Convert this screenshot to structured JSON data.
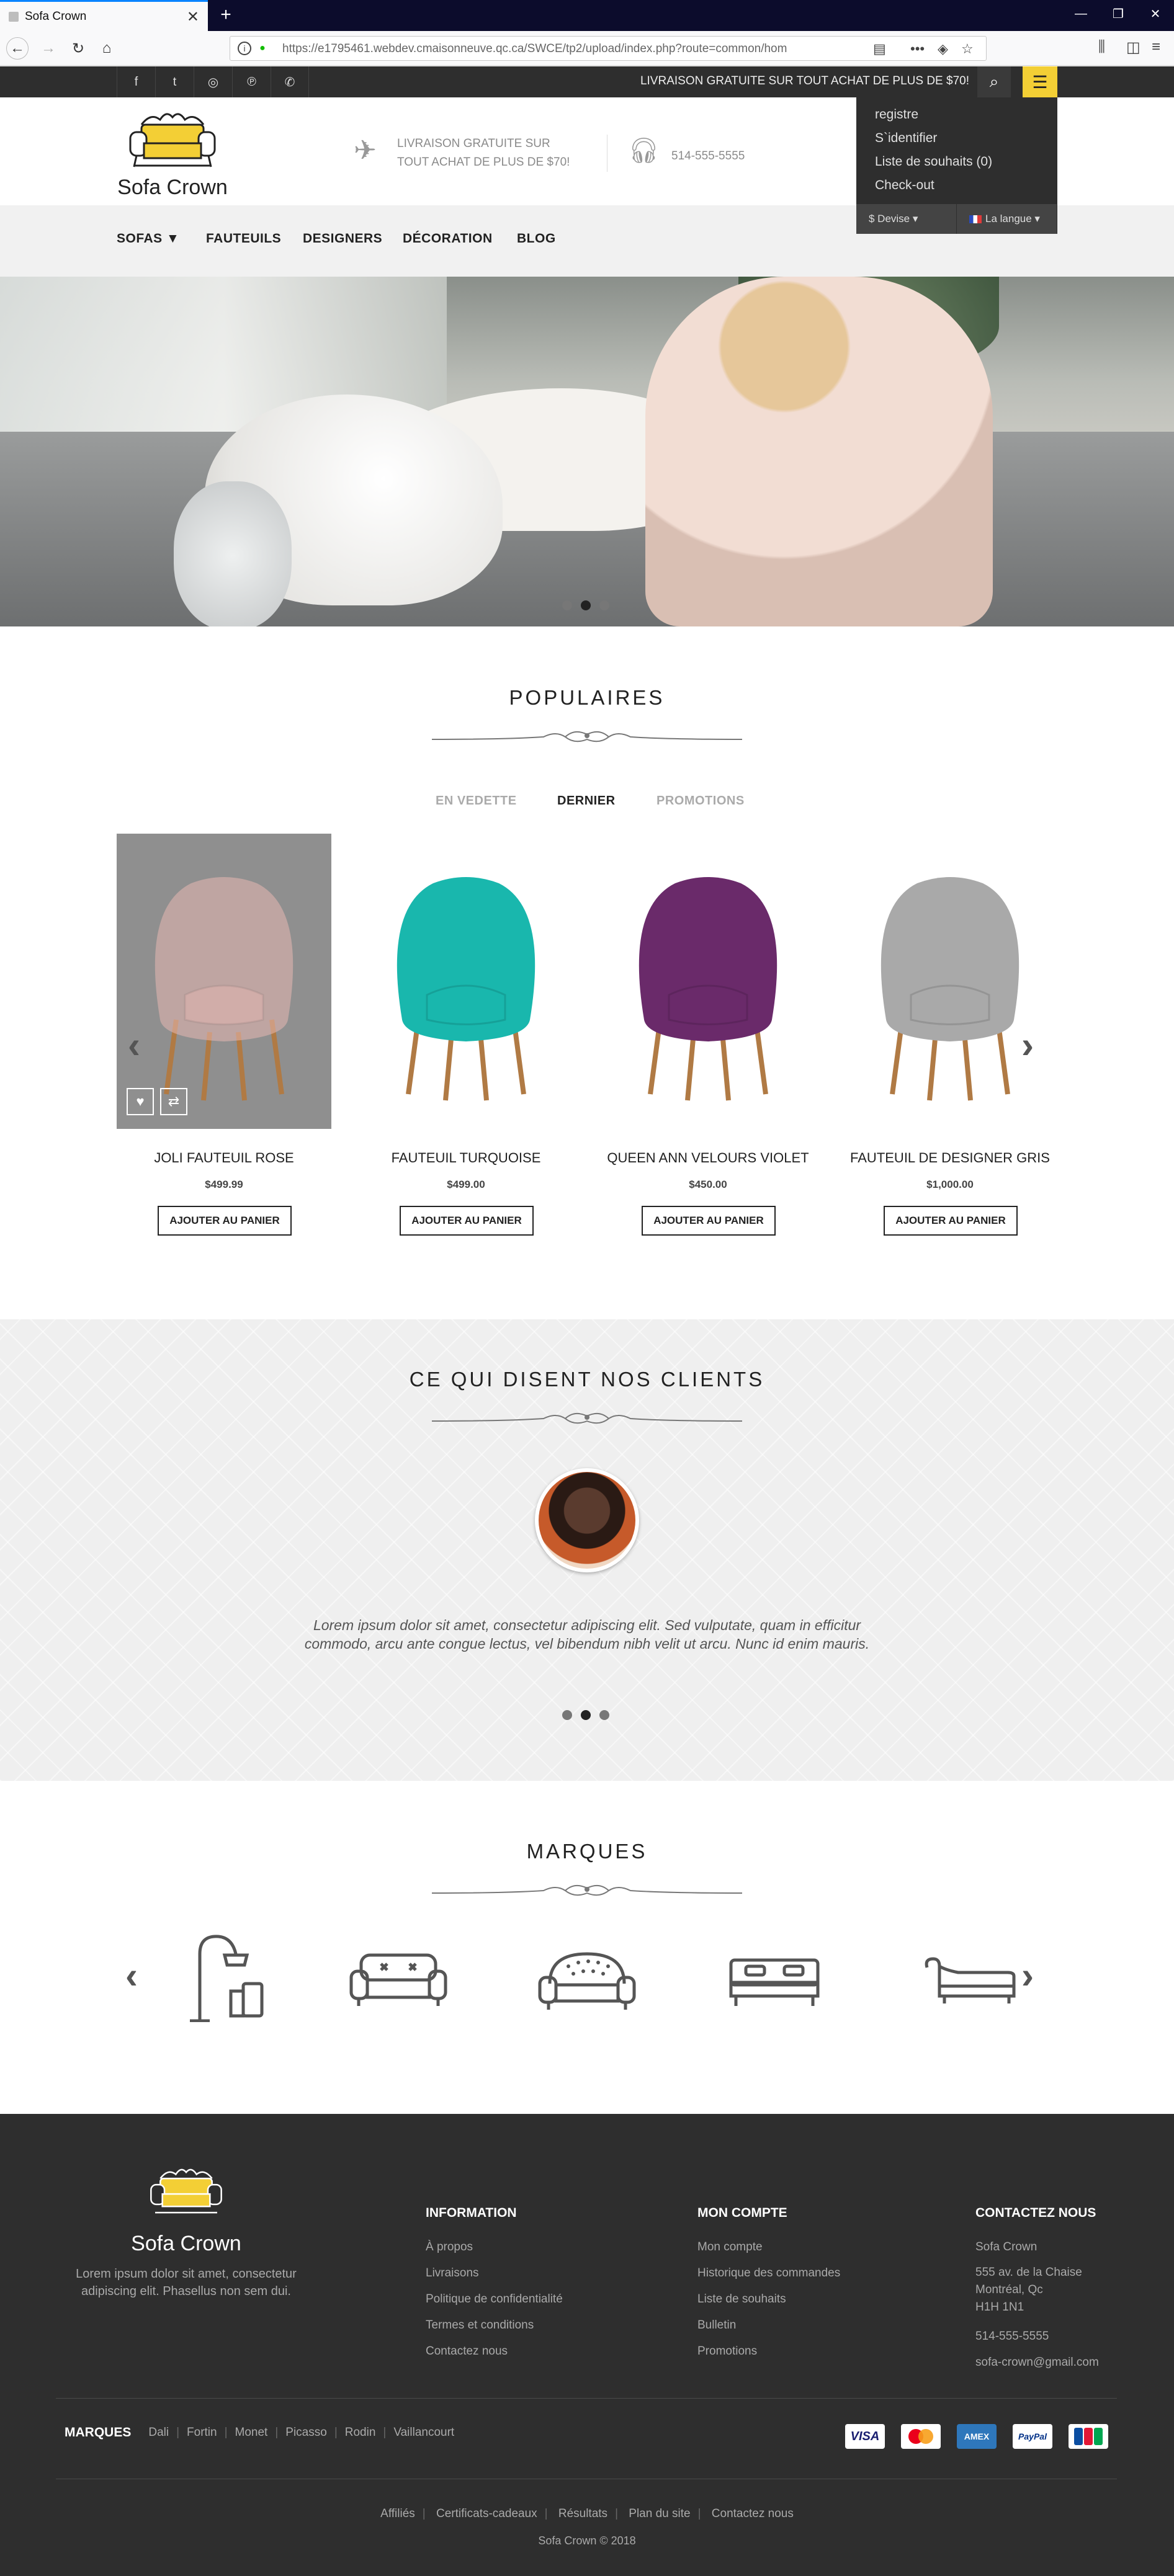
{
  "browser": {
    "tab_title": "Sofa Crown",
    "url": "https://e1795461.webdev.cmaisonneuve.qc.ca/SWCE/tp2/upload/index.php?route=common/hom"
  },
  "topbar": {
    "promo": "LIVRAISON GRATUITE SUR TOUT ACHAT DE PLUS DE $70!",
    "social": [
      "facebook-icon",
      "twitter-icon",
      "instagram-icon",
      "pinterest-icon",
      "whatsapp-icon"
    ]
  },
  "header": {
    "logo_name": "Sofa Crown",
    "shipping_line1": "LIVRAISON GRATUITE SUR",
    "shipping_line2": "TOUT ACHAT DE PLUS DE $70!",
    "phone": "514-555-5555"
  },
  "account_menu": {
    "items": [
      "registre",
      "S`identifier",
      "Liste de souhaits (0)",
      "Check-out"
    ],
    "currency": "$ Devise",
    "language": "La langue"
  },
  "nav": {
    "items": [
      "SOFAS",
      "FAUTEUILS",
      "DESIGNERS",
      "DÉCORATION",
      "BLOG"
    ]
  },
  "populaires": {
    "title": "POPULAIRES",
    "tabs": [
      "EN VEDETTE",
      "DERNIER",
      "PROMOTIONS"
    ],
    "active_tab": "DERNIER",
    "add_label": "AJOUTER AU PANIER",
    "products": [
      {
        "name": "JOLI FAUTEUIL ROSE",
        "price": "$499.99",
        "color": "#e7b8b3"
      },
      {
        "name": "FAUTEUIL TURQUOISE",
        "price": "$499.00",
        "color": "#19b7ad"
      },
      {
        "name": "QUEEN ANN VELOURS VIOLET",
        "price": "$450.00",
        "color": "#6a2a6a"
      },
      {
        "name": "FAUTEUIL DE DESIGNER GRIS",
        "price": "$1,000.00",
        "color": "#a9a9a9"
      }
    ]
  },
  "testimonials": {
    "title": "CE QUI DISENT NOS CLIENTS",
    "quote": "Lorem ipsum dolor sit amet, consectetur adipiscing elit. Sed vulputate, quam in efficitur commodo, arcu ante congue lectus, vel bibendum nibh velit ut arcu. Nunc id enim mauris."
  },
  "brands": {
    "title": "MARQUES",
    "icons": [
      "lamp-chair-icon",
      "sofa-icon",
      "loveseat-icon",
      "bed-icon",
      "chaise-longue-icon"
    ]
  },
  "footer": {
    "logo_name": "Sofa Crown",
    "desc": "Lorem ipsum dolor sit amet, consectetur adipiscing elit. Phasellus non sem dui.",
    "information": {
      "title": "INFORMATION",
      "links": [
        "À propos",
        "Livraisons",
        "Politique de confidentialité",
        "Termes et conditions",
        "Contactez nous"
      ]
    },
    "account": {
      "title": "MON COMPTE",
      "links": [
        "Mon compte",
        "Historique des commandes",
        "Liste de souhaits",
        "Bulletin",
        "Promotions"
      ]
    },
    "contact": {
      "title": "CONTACTEZ NOUS",
      "name": "Sofa Crown",
      "addr1": "555 av. de la Chaise",
      "addr2": "Montréal, Qc",
      "addr3": "H1H 1N1",
      "phone": "514-555-5555",
      "email": "sofa-crown@gmail.com"
    },
    "brands_label": "MARQUES",
    "brands": [
      "Dali",
      "Fortin",
      "Monet",
      "Picasso",
      "Rodin",
      "Vaillancourt"
    ],
    "payments": [
      "VISA",
      "MasterCard",
      "AMEX",
      "PayPal",
      "JCB"
    ],
    "bottom_links": [
      "Affiliés",
      "Certificats-cadeaux",
      "Résultats",
      "Plan du site",
      "Contactez nous"
    ],
    "copyright": "Sofa Crown © 2018"
  }
}
